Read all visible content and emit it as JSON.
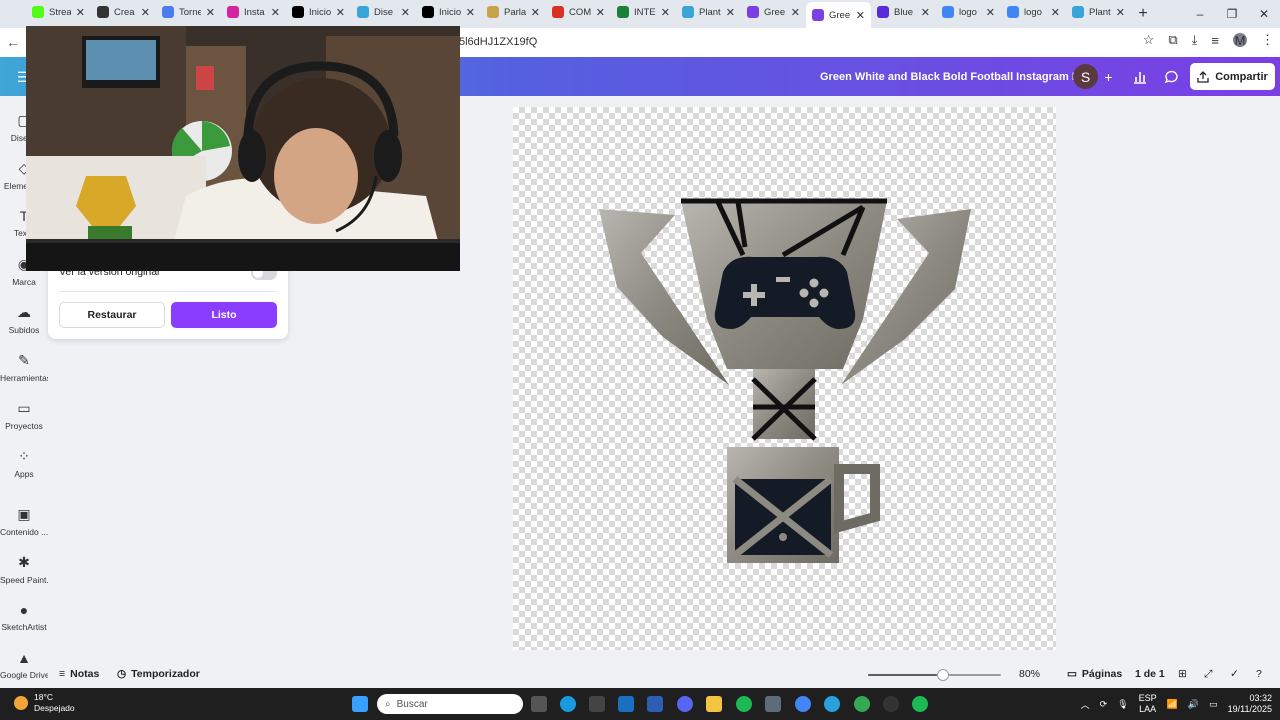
{
  "browser": {
    "tabs": [
      {
        "title": "Strea",
        "icon": "kick-icon",
        "color": "#53fc18"
      },
      {
        "title": "Crea",
        "icon": "openai-icon",
        "color": "#333333"
      },
      {
        "title": "Torne",
        "icon": "docs-icon",
        "color": "#4a7df0"
      },
      {
        "title": "Insta",
        "icon": "instagram-icon",
        "color": "#d6249f"
      },
      {
        "title": "Inicio",
        "icon": "x-icon",
        "color": "#000000"
      },
      {
        "title": "Dise",
        "icon": "canva-icon",
        "color": "#3aa5d8"
      },
      {
        "title": "Inicio",
        "icon": "x-icon",
        "color": "#000000"
      },
      {
        "title": "Parla",
        "icon": "parlay-icon",
        "color": "#c9a24c"
      },
      {
        "title": "COM",
        "icon": "mail-icon",
        "color": "#d93025"
      },
      {
        "title": "INTE",
        "icon": "sheets-icon",
        "color": "#188038"
      },
      {
        "title": "Plant",
        "icon": "canva-icon",
        "color": "#3aa5d8"
      },
      {
        "title": "Gree",
        "icon": "canva-icon",
        "color": "#7b3fe4"
      },
      {
        "title": "Gree",
        "icon": "canva-icon",
        "color": "#7b3fe4",
        "active": true
      },
      {
        "title": "Blue",
        "icon": "canva-icon",
        "color": "#5a2bd8"
      },
      {
        "title": "logo",
        "icon": "google-icon",
        "color": "#4285f4"
      },
      {
        "title": "logo",
        "icon": "google-icon",
        "color": "#4285f4"
      },
      {
        "title": "Plant",
        "icon": "canva-icon",
        "color": "#3aa5d8"
      }
    ],
    "url_fragment": "5l6dHJ1ZX19fQ"
  },
  "header": {
    "doc_title": "Green White and Black Bold Football Instagram Post",
    "avatar_letter": "S",
    "share_label": "Compartir"
  },
  "sidebar": {
    "items": [
      {
        "label": "Diseño",
        "icon": "design-icon",
        "glyph": "▢"
      },
      {
        "label": "Elementos",
        "icon": "elements-icon",
        "glyph": "◇"
      },
      {
        "label": "Texto",
        "icon": "text-icon",
        "glyph": "T"
      },
      {
        "label": "Marca",
        "icon": "brand-icon",
        "glyph": "◉"
      },
      {
        "label": "Subidos",
        "icon": "upload-icon",
        "glyph": "☁"
      },
      {
        "label": "Herramientas",
        "icon": "pen-icon",
        "glyph": "✎"
      },
      {
        "label": "Proyectos",
        "icon": "folder-icon",
        "glyph": "▭"
      },
      {
        "label": "Apps",
        "icon": "apps-icon",
        "glyph": "⁘"
      },
      {
        "label": "Contenido ...",
        "icon": "image-icon",
        "glyph": "▣"
      },
      {
        "label": "Speed Paint...",
        "icon": "speedpaint-icon",
        "glyph": "✱"
      },
      {
        "label": "SketchArtist",
        "icon": "sketchartist-icon",
        "glyph": "●"
      },
      {
        "label": "Google Drive",
        "icon": "drive-icon",
        "glyph": "▲"
      }
    ]
  },
  "panel": {
    "original_label": "Ver la versión original",
    "restore_label": "Restaurar",
    "done_label": "Listo"
  },
  "bottom": {
    "notes_label": "Notas",
    "timer_label": "Temporizador",
    "zoom_value": 80,
    "zoom_label": "80%",
    "pages_label": "Páginas",
    "page_count": "1 de 1"
  },
  "taskbar": {
    "temperature": "18°C",
    "weather": "Despejado",
    "search_placeholder": "Buscar",
    "lang_top": "ESP",
    "lang_bottom": "LAA",
    "time": "03:32",
    "date": "19/11/2025",
    "notif_badge": "5"
  }
}
